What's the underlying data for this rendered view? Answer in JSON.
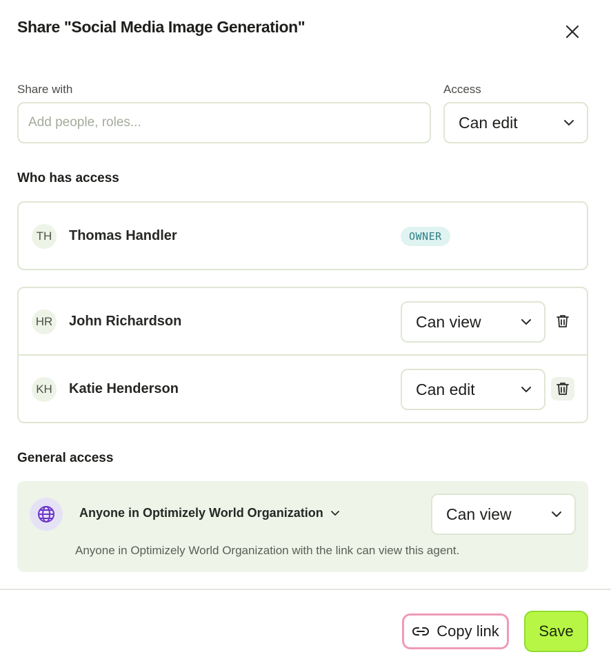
{
  "dialog": {
    "title": "Share \"Social Media Image Generation\""
  },
  "share": {
    "share_with_label": "Share with",
    "input_placeholder": "Add people, roles...",
    "input_value": "",
    "access_label": "Access",
    "access_value": "Can edit"
  },
  "who_has_access": {
    "title": "Who has access",
    "owner": {
      "initials": "TH",
      "name": "Thomas Handler",
      "badge": "OWNER"
    },
    "members": [
      {
        "initials": "HR",
        "name": "John Richardson",
        "access": "Can view"
      },
      {
        "initials": "KH",
        "name": "Katie Henderson",
        "access": "Can edit"
      }
    ]
  },
  "general_access": {
    "title": "General access",
    "org_option": "Anyone in Optimizely World Organization",
    "access": "Can view",
    "description": "Anyone in Optimizely World Organization with the link can view this agent."
  },
  "footer": {
    "copy_link_label": "Copy link",
    "save_label": "Save"
  },
  "icons": {
    "close": "close-icon",
    "chevron": "chevron-down-icon",
    "trash": "trash-icon",
    "globe": "globe-icon",
    "link": "link-icon"
  },
  "colors": {
    "save_accent": "#b8f646",
    "copy_link_outline": "#f09ab8",
    "owner_badge_bg": "#dff3f1",
    "owner_badge_text": "#2f7f86",
    "general_access_bg": "#eef4e8",
    "globe_bg": "#e6e2f6",
    "globe_icon": "#6a35c9"
  }
}
